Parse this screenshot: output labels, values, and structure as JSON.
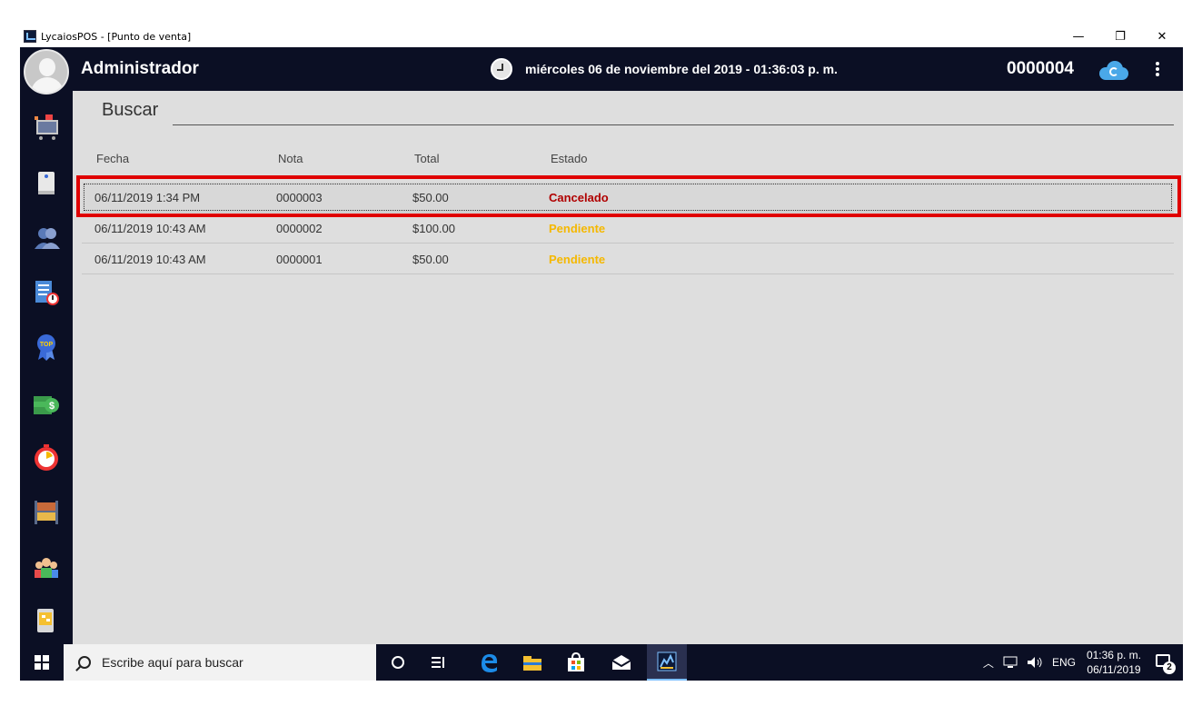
{
  "window": {
    "title": "LycaiosPOS - [Punto de venta]",
    "controls": {
      "minimize": "—",
      "restore": "❐",
      "close": "✕"
    }
  },
  "header": {
    "user": "Administrador",
    "datetime": "miércoles 06 de noviembre del 2019 - 01:36:03 p. m.",
    "ticket_number": "0000004"
  },
  "sidebar": {
    "items": [
      {
        "icon": "cart-icon"
      },
      {
        "icon": "notes-icon"
      },
      {
        "icon": "customers-icon"
      },
      {
        "icon": "history-icon"
      },
      {
        "icon": "top-badge-icon"
      },
      {
        "icon": "money-icon"
      },
      {
        "icon": "timer-icon"
      },
      {
        "icon": "inventory-icon"
      },
      {
        "icon": "users-icon"
      },
      {
        "icon": "report-icon"
      }
    ]
  },
  "search": {
    "label": "Buscar",
    "value": ""
  },
  "table": {
    "columns": [
      "Fecha",
      "Nota",
      "Total",
      "Estado"
    ],
    "rows": [
      {
        "fecha": "06/11/2019 1:34 PM",
        "nota": "0000003",
        "total": "$50.00",
        "estado": "Cancelado",
        "estado_color": "#b00000",
        "selected": true
      },
      {
        "fecha": "06/11/2019 10:43 AM",
        "nota": "0000002",
        "total": "$100.00",
        "estado": "Pendiente",
        "estado_color": "#f5b800",
        "selected": false
      },
      {
        "fecha": "06/11/2019 10:43 AM",
        "nota": "0000001",
        "total": "$50.00",
        "estado": "Pendiente",
        "estado_color": "#f5b800",
        "selected": false
      }
    ]
  },
  "taskbar": {
    "search_placeholder": "Escribe aquí para buscar",
    "language": "ENG",
    "time": "01:36 p. m.",
    "date": "06/11/2019",
    "notifications": "2"
  },
  "colors": {
    "header_bg": "#0b0f24",
    "content_bg": "#dedede",
    "selection_border": "#e00000",
    "cancelled": "#b00000",
    "pending": "#f5b800",
    "cloud": "#4aa8e8"
  }
}
